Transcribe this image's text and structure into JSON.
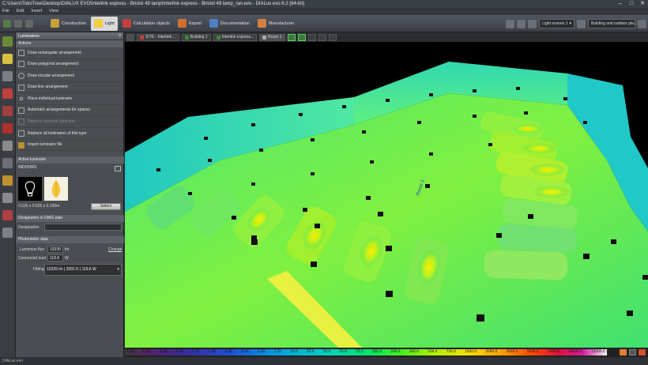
{
  "window": {
    "title": "C:\\Users\\TokoTree\\Desktop\\DIALUX EVO\\Interlink express - Bristol 49 lamp\\Interlink express - Bristol 49 lamp_ran.evo - DIALux evo 6.2 (64-bit)"
  },
  "menu": [
    "File",
    "Edit",
    "Insert",
    "View"
  ],
  "modes": [
    {
      "label": "Construction",
      "color": "#c8a03c"
    },
    {
      "label": "Light",
      "color": "#f0d040"
    },
    {
      "label": "Calculation objects",
      "color": "#c04040"
    },
    {
      "label": "Export",
      "color": "#d07030"
    },
    {
      "label": "Documentation",
      "color": "#5080c0"
    },
    {
      "label": "Manufacturer",
      "color": "#d08040"
    }
  ],
  "toolbar_right": {
    "light_scene": "Light scenes 1",
    "view_select": "Building and outdoor pla..."
  },
  "panel": {
    "title": "Luminaires",
    "help": "?",
    "actions_header": "Actions",
    "actions": [
      {
        "label": "Draw rectangular arrangement",
        "enabled": true
      },
      {
        "label": "Draw polygonal arrangement",
        "enabled": true
      },
      {
        "label": "Draw circular arrangement",
        "enabled": true
      },
      {
        "label": "Draw line arrangement",
        "enabled": true
      },
      {
        "label": "Place individual luminaire",
        "enabled": true
      },
      {
        "label": "Automatic arrangements for spaces",
        "enabled": true
      },
      {
        "label": "Replace selected luminaire",
        "enabled": false
      },
      {
        "label": "Replace all luminaires of this type",
        "enabled": true
      },
      {
        "label": "Import luminaire file",
        "enabled": true
      }
    ],
    "active_header": "Active luminaire",
    "active_name": "INDOORS",
    "dimensions": "0.525 x 0.525 x 0.100m",
    "select_label": "Select",
    "designation_header": "Designation in DWG plan",
    "designation_label": "Designation",
    "designation_value": "",
    "photometric_header": "Photometric data",
    "luminous_flux_label": "Luminous flux",
    "luminous_flux_value": "10339",
    "luminous_flux_unit": "lm",
    "change_label": "Change",
    "connected_load_label": "Connected load",
    "connected_load_value": "119.6",
    "connected_load_unit": "W",
    "fitting_label": "Fitting",
    "fitting_value": "10339 lm  |  3991 K  |  119.6 W"
  },
  "viewport": {
    "breadcrumbs": [
      "SITE - Interlink ...",
      "Building 1",
      "Interlink express...",
      "Room 1"
    ],
    "room_label": "Room 1"
  },
  "scale": {
    "values": [
      "0.10",
      "0.20",
      "0.30",
      "0.50",
      "0.75",
      "1.00",
      "2.00",
      "3.00",
      "5.00",
      "7.50",
      "10.0",
      "20.0",
      "30.0",
      "50.0",
      "75.0",
      "100.0",
      "200.0",
      "300.0",
      "500.0",
      "750.0",
      "1000.0",
      "2000.0",
      "3000.0",
      "5000.0",
      "7500.0",
      "10000.0",
      "15000.0"
    ]
  },
  "status": {
    "text": "DIALux evo"
  }
}
